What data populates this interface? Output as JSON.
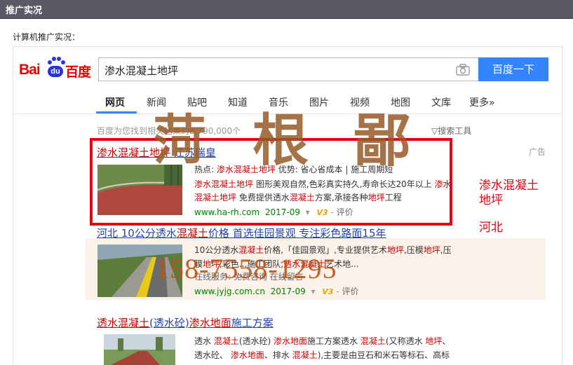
{
  "topbar": {
    "title": "推广实况"
  },
  "pc_label": "计算机推广实况：",
  "logo": {
    "bai": "Bai",
    "du": "du",
    "baidu_cn": "百度"
  },
  "search": {
    "query": "渗水混凝土地坪",
    "button_label": "百度一下"
  },
  "tabs": [
    {
      "label": "网页",
      "active": true
    },
    {
      "label": "新闻"
    },
    {
      "label": "贴吧"
    },
    {
      "label": "知道"
    },
    {
      "label": "音乐"
    },
    {
      "label": "图片"
    },
    {
      "label": "视频"
    },
    {
      "label": "地图"
    },
    {
      "label": "文库"
    },
    {
      "label": "更多»"
    }
  ],
  "results_info": "百度为您找到相关结果约8,790,000个",
  "search_tools": "▽搜索工具",
  "ad_tag": "广告",
  "results": [
    {
      "title_em": "渗水混凝土地坪",
      "title_rest": " 江苏瑞皇",
      "line1": [
        "热点: ",
        "渗水混凝土地坪",
        "  优势: 省心省成本 | 施工周期短"
      ],
      "line2": [
        "渗水混凝土地坪",
        " 图形美观自然,色彩真实持久,寿命长达20年以上 ",
        "渗水"
      ],
      "line3": [
        "混凝土地坪",
        " 免费提供透水",
        "混凝土",
        "方案,承接各种",
        "地坪",
        "工程"
      ],
      "url": "www.ha-rh.com",
      "date": "2017-09",
      "eval": "评价"
    },
    {
      "title_parts": [
        "河北 10公分透水",
        "混凝土",
        "价格 首选佳园景观 专注彩色路面15年"
      ],
      "line1": [
        "10公分透水",
        "混凝土",
        "价格,「佳园景观」,专业提供艺术",
        "地坪",
        ",压模",
        "地坪",
        ",压"
      ],
      "line2": [
        "膜",
        "地坪",
        ",彩色",
        "...施工团队,",
        "透水混凝土",
        "艺术地..."
      ],
      "line3": "在线服务: 免费咨询 在线留言",
      "url": "www.jyjg.com.cn",
      "date": "2017-09",
      "eval": "评价"
    },
    {
      "title_parts": [
        "透水混凝土",
        "(透水砼)",
        "渗水地面",
        "施工方案"
      ],
      "line1": [
        "透水 ",
        "混凝土",
        "(透水砼) ",
        "渗水地面",
        "施工方案透水 ",
        "混凝土",
        "(又称透水 ",
        "地坪",
        "、"
      ],
      "line2": [
        "透水砼、 ",
        "渗水地面",
        "、排水 ",
        "混凝土",
        "),主要是由豆石和米石等标石、高标"
      ]
    }
  ],
  "annotation": {
    "keyword_line1": "渗水混凝土",
    "keyword_line2": "地坪",
    "region": "河北"
  },
  "watermark": {
    "chars": [
      "菏",
      "根",
      "鄙"
    ],
    "phone": "158-7558-1295"
  },
  "colors": {
    "topbar": "#5a5a64",
    "baidu_red": "#e10601",
    "baidu_blue": "#2932e1",
    "button": "#3385ff",
    "link": "#2440b3",
    "highlight": "#c00",
    "url_green": "#008000",
    "annotation_red": "#e50012"
  }
}
